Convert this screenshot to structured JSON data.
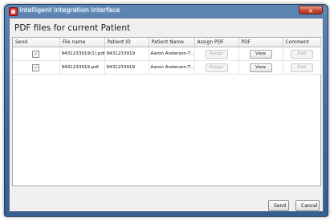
{
  "window": {
    "title": "Intelligent Integration Interface",
    "close_glyph": "×"
  },
  "dialog": {
    "heading": "PDF files for current Patient"
  },
  "table": {
    "columns": [
      "Send",
      "File name",
      "Patient ID",
      "Patient Name",
      "Assign PDF",
      "PDF",
      "Comment"
    ],
    "rows": [
      {
        "send_checked": "✓",
        "file_name": "9431233919(1).pdf",
        "patient_id": "9431233919",
        "patient_name": "Aaron Anderson-T...",
        "assign_label": "Assign",
        "view_label": "View",
        "add_label": "Add"
      },
      {
        "send_checked": "✓",
        "file_name": "9431233919.pdf",
        "patient_id": "9431233919",
        "patient_name": "Aaron Anderson-T...",
        "assign_label": "Assign",
        "view_label": "View",
        "add_label": "Add"
      }
    ]
  },
  "footer": {
    "send_label": "Send",
    "cancel_label": "Cancel"
  },
  "colors": {
    "titlebar": "#3e6796",
    "close_button": "#cd4d35",
    "client_background": "#f1f0ee"
  },
  "icons": {
    "app": "app-icon",
    "close": "close-icon",
    "checkbox": "checkbox-checked-icon"
  }
}
